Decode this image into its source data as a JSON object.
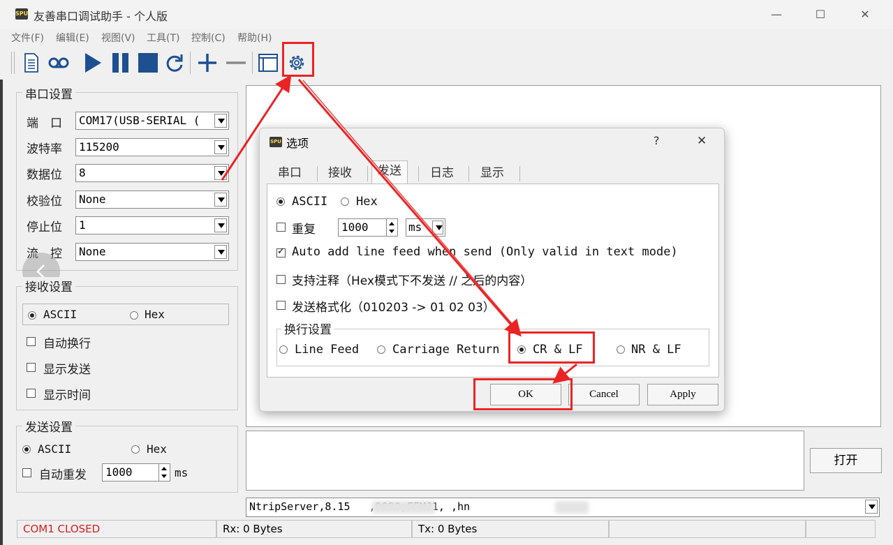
{
  "window": {
    "icon_text": "SPU",
    "title": "友善串口调试助手 - 个人版",
    "minimize": "—",
    "maximize": "☐",
    "close": "✕"
  },
  "menu": [
    "文件(F)",
    "编辑(E)",
    "视图(V)",
    "工具(T)",
    "控制(C)",
    "帮助(H)"
  ],
  "toolbar": {
    "icons": [
      "new-file-icon",
      "record-icon",
      "play-icon",
      "pause-icon",
      "stop-icon",
      "refresh-icon",
      "plus-icon",
      "minus-icon",
      "window-icon",
      "gear-icon"
    ]
  },
  "serial_settings": {
    "title": "串口设置",
    "fields": [
      {
        "label": "端　口",
        "value": "COM17(USB-SERIAL ("
      },
      {
        "label": "波特率",
        "value": "115200"
      },
      {
        "label": "数据位",
        "value": "8"
      },
      {
        "label": "校验位",
        "value": "None"
      },
      {
        "label": "停止位",
        "value": "1"
      },
      {
        "label": "流　控",
        "value": "None"
      }
    ]
  },
  "receive_settings": {
    "title": "接收设置",
    "mode_ascii": "ASCII",
    "mode_hex": "Hex",
    "options": [
      "自动换行",
      "显示发送",
      "显示时间"
    ]
  },
  "send_settings": {
    "title": "发送设置",
    "mode_ascii": "ASCII",
    "mode_hex": "Hex",
    "auto_resend": "自动重发",
    "interval": "1000",
    "unit": "ms"
  },
  "open_button": "打开",
  "history_value": "NtripServer,8.15   ,9090,FFMJ1, ,hn",
  "status": {
    "port": "COM1 CLOSED",
    "rx": "Rx: 0 Bytes",
    "tx": "Tx: 0 Bytes",
    "port_color": "#d62020"
  },
  "dialog": {
    "icon_text": "SPU",
    "title": "选项",
    "help": "?",
    "close": "✕",
    "tabs": [
      "串口",
      "接收",
      "发送",
      "日志",
      "显示"
    ],
    "active_tab": "发送",
    "mode_ascii": "ASCII",
    "mode_hex": "Hex",
    "repeat_label": "重复",
    "repeat_value": "1000",
    "repeat_unit": "ms",
    "auto_linefeed": "Auto add line feed when send (Only valid in text mode)",
    "comment_support": "支持注释（Hex模式下不发送 // 之后的内容）",
    "format_send": "发送格式化（010203 -> 01 02 03）",
    "newline_group": "换行设置",
    "newline_options": [
      "Line Feed",
      "Carriage Return",
      "CR & LF",
      "NR & LF"
    ],
    "newline_selected": "CR & LF",
    "ok": "OK",
    "cancel": "Cancel",
    "apply": "Apply"
  },
  "annotation_color": "#ea2424"
}
